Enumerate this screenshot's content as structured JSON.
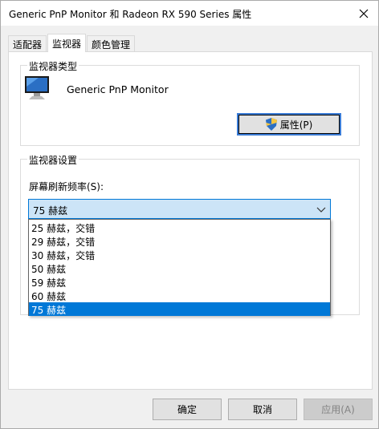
{
  "window": {
    "title": "Generic PnP Monitor 和 Radeon RX 590 Series 属性"
  },
  "tabs": [
    {
      "label": "适配器"
    },
    {
      "label": "监视器"
    },
    {
      "label": "颜色管理"
    }
  ],
  "monitor_type": {
    "group_title": "监视器类型",
    "monitor_name": "Generic PnP Monitor",
    "properties_button": "属性(P)"
  },
  "monitor_settings": {
    "group_title": "监视器设置",
    "refresh_label": "屏幕刷新频率(S):",
    "refresh_selected": "75 赫兹",
    "refresh_options": [
      "25 赫兹，交错",
      "29 赫兹，交错",
      "30 赫兹，交错",
      "50 赫兹",
      "59 赫兹",
      "60 赫兹",
      "75 赫兹"
    ]
  },
  "buttons": {
    "ok": "确定",
    "cancel": "取消",
    "apply": "应用(A)"
  },
  "colors": {
    "accent": "#0078d7",
    "combo_bg": "#cce4f7"
  }
}
